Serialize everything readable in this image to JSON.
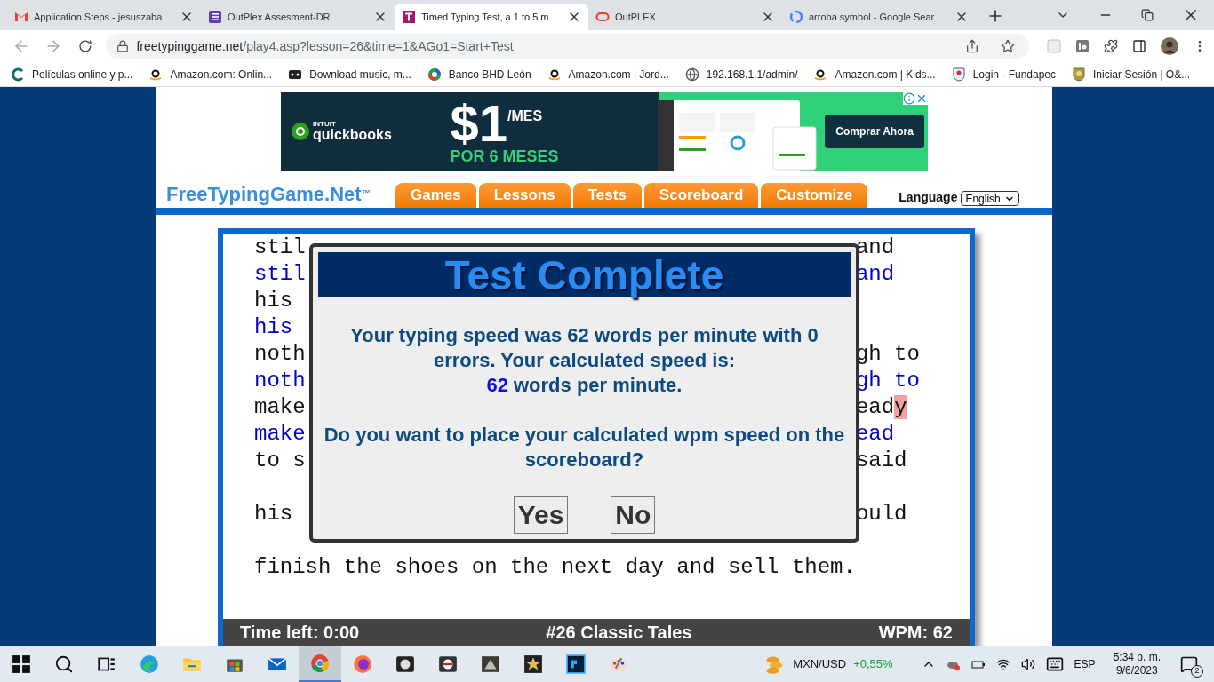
{
  "tabs": [
    {
      "title": "Application Steps - jesuszaba",
      "kind": "mail",
      "selected": false
    },
    {
      "title": "OutPlex Assesment-DR",
      "kind": "form",
      "selected": false
    },
    {
      "title": "Timed Typing Test, a 1 to 5 m",
      "kind": "typing",
      "selected": true
    },
    {
      "title": "OutPLEX",
      "kind": "ring",
      "selected": false
    },
    {
      "title": "arroba symbol - Google Sear",
      "kind": "google",
      "selected": false
    }
  ],
  "address": {
    "host": "freetypinggame.net",
    "path": "/play4.asp?lesson=26&time=1&AGo1=Start+Test"
  },
  "bookmarks": [
    {
      "label": "Películas online y p...",
      "kind": "c"
    },
    {
      "label": "Amazon.com: Onlin...",
      "kind": "amazon"
    },
    {
      "label": "Download music, m...",
      "kind": "music"
    },
    {
      "label": "Banco BHD León",
      "kind": "bank"
    },
    {
      "label": "Amazon.com | Jord...",
      "kind": "amazon"
    },
    {
      "label": "192.168.1.1/admin/",
      "kind": "globe"
    },
    {
      "label": "Amazon.com | Kids...",
      "kind": "amazon"
    },
    {
      "label": "Login - Fundapec",
      "kind": "crest"
    },
    {
      "label": "Iniciar Sesión | O&...",
      "kind": "shield"
    }
  ],
  "ad": {
    "brand_small": "INTUIT",
    "brand": "quickbooks",
    "price": "$1",
    "per": "/MES",
    "offer": "POR 6 MESES",
    "cta": "Comprar Ahora"
  },
  "site": {
    "logo": "FreeTypingGame.Net$^{™}$",
    "nav": [
      "Games",
      "Lessons",
      "Tests",
      "Scoreboard",
      "Customize"
    ],
    "language_label": "Language",
    "language": "English"
  },
  "typing": {
    "lines": [
      {
        "kind": "source",
        "left": "stil",
        "right": [
          {
            "text": "and",
            "highlight": false
          }
        ]
      },
      {
        "kind": "typed",
        "left": "stil",
        "right": [
          {
            "text": "and",
            "highlight": false
          }
        ]
      },
      {
        "kind": "source",
        "left": "his"
      },
      {
        "kind": "typed",
        "left": "his"
      },
      {
        "kind": "source",
        "left": "noth",
        "right": [
          {
            "text": "gh to",
            "highlight": false
          }
        ]
      },
      {
        "kind": "typed",
        "left": "noth",
        "right": [
          {
            "text": "gh to",
            "highlight": false
          }
        ]
      },
      {
        "kind": "source",
        "left": "make",
        "right": [
          {
            "text": "ead",
            "highlight": false
          },
          {
            "text": "y",
            "highlight": true
          }
        ]
      },
      {
        "kind": "typed",
        "left": "make",
        "right": [
          {
            "text": "ead",
            "highlight": false
          }
        ]
      },
      {
        "kind": "source",
        "left": "to s",
        "right": [
          {
            "text": "said",
            "highlight": false
          }
        ]
      },
      {
        "kind": "blank"
      },
      {
        "kind": "source",
        "left": "his",
        "right": [
          {
            "text": "ould",
            "highlight": false
          }
        ]
      },
      {
        "kind": "blank"
      },
      {
        "kind": "source",
        "left": "finish the shoes on the next day and sell them."
      }
    ],
    "status": {
      "time_left": "Time left: 0:00",
      "lesson": "#26 Classic Tales",
      "wpm": "WPM: 62"
    }
  },
  "dialog": {
    "title": "Test Complete",
    "result": "Your typing speed was 62 words per minute with 0 errors. Your calculated speed is:",
    "speed": "62",
    "speed_unit": "words per minute.",
    "question": "Do you want to place your calculated wpm speed on the scoreboard?",
    "buttons": [
      "Yes",
      "No"
    ]
  },
  "taskbar": {
    "apps": [
      {
        "selected": false
      },
      {
        "selected": false
      },
      {
        "selected": false
      },
      {
        "selected": false
      },
      {
        "selected": false
      },
      {
        "selected": false
      },
      {
        "selected": false
      },
      {
        "selected": true
      },
      {
        "selected": false
      },
      {
        "selected": false
      },
      {
        "selected": false
      },
      {
        "selected": false
      },
      {
        "selected": false
      },
      {
        "selected": false
      },
      {
        "selected": false
      }
    ],
    "ticker": "MXN/USD",
    "change": "+0,55%",
    "language": "ESP",
    "time": "5:34 p. m.",
    "date": "9/6/2023",
    "notifications": "2"
  }
}
